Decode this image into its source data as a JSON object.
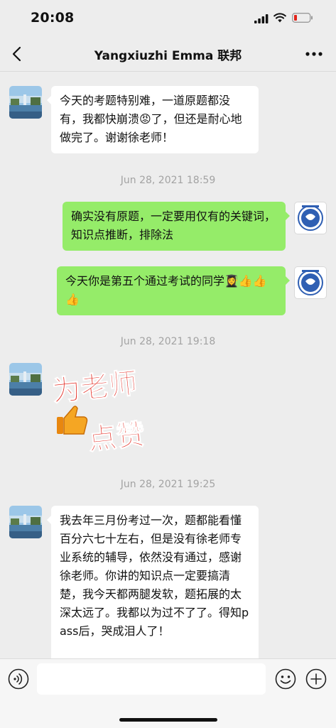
{
  "status_bar": {
    "time": "20:08"
  },
  "header": {
    "title": "Yangxiuzhi Emma 联邦"
  },
  "messages": [
    {
      "side": "left",
      "text": "今天的考题特别难，一道原题都没有，我都快崩溃😡了，但还是耐心地做完了。谢谢徐老师！"
    },
    {
      "type": "timestamp",
      "text": "Jun 28, 2021 18:59"
    },
    {
      "side": "right",
      "text": "确实没有原题，一定要用仅有的关键词，知识点推断，排除法"
    },
    {
      "side": "right",
      "text": "今天你是第五个通过考试的同学👩‍🎓👍👍👍"
    },
    {
      "type": "timestamp",
      "text": "Jun 28, 2021 19:18"
    },
    {
      "side": "left",
      "type": "sticker",
      "line1": "为老师",
      "line2": "点赞"
    },
    {
      "type": "timestamp",
      "text": "Jun 28, 2021 19:25"
    },
    {
      "side": "left",
      "text": "我去年三月份考过一次，题都能看懂百分六七十左右，但是没有徐老师专业系统的辅导，依然没有通过，感谢徐老师。你讲的知识点一定要搞清楚，我今天都两腿发软，题拓展的太深太远了。我都以为过不了了。得知pass后，哭成泪人了！"
    }
  ],
  "input": {
    "value": "",
    "placeholder": ""
  },
  "icons": {
    "back": "chevron-left-icon",
    "more": "more-dots-icon",
    "voice": "voice-icon",
    "emoji": "emoji-icon",
    "plus": "plus-icon"
  },
  "colors": {
    "background": "#ededed",
    "bubble_self": "#95ec69",
    "bubble_other": "#ffffff",
    "timestamp": "#a3a3a3",
    "sticker_text": "#e2231a"
  }
}
